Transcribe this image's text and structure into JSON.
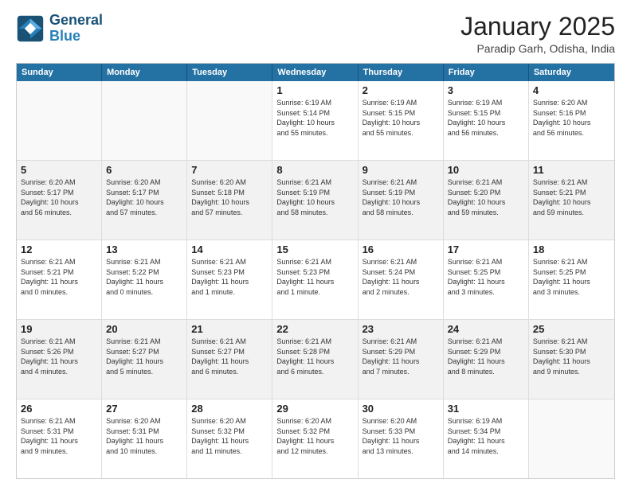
{
  "logo": {
    "line1": "General",
    "line2": "Blue"
  },
  "title": "January 2025",
  "location": "Paradip Garh, Odisha, India",
  "weekdays": [
    "Sunday",
    "Monday",
    "Tuesday",
    "Wednesday",
    "Thursday",
    "Friday",
    "Saturday"
  ],
  "rows": [
    [
      {
        "day": "",
        "text": ""
      },
      {
        "day": "",
        "text": ""
      },
      {
        "day": "",
        "text": ""
      },
      {
        "day": "1",
        "text": "Sunrise: 6:19 AM\nSunset: 5:14 PM\nDaylight: 10 hours\nand 55 minutes."
      },
      {
        "day": "2",
        "text": "Sunrise: 6:19 AM\nSunset: 5:15 PM\nDaylight: 10 hours\nand 55 minutes."
      },
      {
        "day": "3",
        "text": "Sunrise: 6:19 AM\nSunset: 5:15 PM\nDaylight: 10 hours\nand 56 minutes."
      },
      {
        "day": "4",
        "text": "Sunrise: 6:20 AM\nSunset: 5:16 PM\nDaylight: 10 hours\nand 56 minutes."
      }
    ],
    [
      {
        "day": "5",
        "text": "Sunrise: 6:20 AM\nSunset: 5:17 PM\nDaylight: 10 hours\nand 56 minutes."
      },
      {
        "day": "6",
        "text": "Sunrise: 6:20 AM\nSunset: 5:17 PM\nDaylight: 10 hours\nand 57 minutes."
      },
      {
        "day": "7",
        "text": "Sunrise: 6:20 AM\nSunset: 5:18 PM\nDaylight: 10 hours\nand 57 minutes."
      },
      {
        "day": "8",
        "text": "Sunrise: 6:21 AM\nSunset: 5:19 PM\nDaylight: 10 hours\nand 58 minutes."
      },
      {
        "day": "9",
        "text": "Sunrise: 6:21 AM\nSunset: 5:19 PM\nDaylight: 10 hours\nand 58 minutes."
      },
      {
        "day": "10",
        "text": "Sunrise: 6:21 AM\nSunset: 5:20 PM\nDaylight: 10 hours\nand 59 minutes."
      },
      {
        "day": "11",
        "text": "Sunrise: 6:21 AM\nSunset: 5:21 PM\nDaylight: 10 hours\nand 59 minutes."
      }
    ],
    [
      {
        "day": "12",
        "text": "Sunrise: 6:21 AM\nSunset: 5:21 PM\nDaylight: 11 hours\nand 0 minutes."
      },
      {
        "day": "13",
        "text": "Sunrise: 6:21 AM\nSunset: 5:22 PM\nDaylight: 11 hours\nand 0 minutes."
      },
      {
        "day": "14",
        "text": "Sunrise: 6:21 AM\nSunset: 5:23 PM\nDaylight: 11 hours\nand 1 minute."
      },
      {
        "day": "15",
        "text": "Sunrise: 6:21 AM\nSunset: 5:23 PM\nDaylight: 11 hours\nand 1 minute."
      },
      {
        "day": "16",
        "text": "Sunrise: 6:21 AM\nSunset: 5:24 PM\nDaylight: 11 hours\nand 2 minutes."
      },
      {
        "day": "17",
        "text": "Sunrise: 6:21 AM\nSunset: 5:25 PM\nDaylight: 11 hours\nand 3 minutes."
      },
      {
        "day": "18",
        "text": "Sunrise: 6:21 AM\nSunset: 5:25 PM\nDaylight: 11 hours\nand 3 minutes."
      }
    ],
    [
      {
        "day": "19",
        "text": "Sunrise: 6:21 AM\nSunset: 5:26 PM\nDaylight: 11 hours\nand 4 minutes."
      },
      {
        "day": "20",
        "text": "Sunrise: 6:21 AM\nSunset: 5:27 PM\nDaylight: 11 hours\nand 5 minutes."
      },
      {
        "day": "21",
        "text": "Sunrise: 6:21 AM\nSunset: 5:27 PM\nDaylight: 11 hours\nand 6 minutes."
      },
      {
        "day": "22",
        "text": "Sunrise: 6:21 AM\nSunset: 5:28 PM\nDaylight: 11 hours\nand 6 minutes."
      },
      {
        "day": "23",
        "text": "Sunrise: 6:21 AM\nSunset: 5:29 PM\nDaylight: 11 hours\nand 7 minutes."
      },
      {
        "day": "24",
        "text": "Sunrise: 6:21 AM\nSunset: 5:29 PM\nDaylight: 11 hours\nand 8 minutes."
      },
      {
        "day": "25",
        "text": "Sunrise: 6:21 AM\nSunset: 5:30 PM\nDaylight: 11 hours\nand 9 minutes."
      }
    ],
    [
      {
        "day": "26",
        "text": "Sunrise: 6:21 AM\nSunset: 5:31 PM\nDaylight: 11 hours\nand 9 minutes."
      },
      {
        "day": "27",
        "text": "Sunrise: 6:20 AM\nSunset: 5:31 PM\nDaylight: 11 hours\nand 10 minutes."
      },
      {
        "day": "28",
        "text": "Sunrise: 6:20 AM\nSunset: 5:32 PM\nDaylight: 11 hours\nand 11 minutes."
      },
      {
        "day": "29",
        "text": "Sunrise: 6:20 AM\nSunset: 5:32 PM\nDaylight: 11 hours\nand 12 minutes."
      },
      {
        "day": "30",
        "text": "Sunrise: 6:20 AM\nSunset: 5:33 PM\nDaylight: 11 hours\nand 13 minutes."
      },
      {
        "day": "31",
        "text": "Sunrise: 6:19 AM\nSunset: 5:34 PM\nDaylight: 11 hours\nand 14 minutes."
      },
      {
        "day": "",
        "text": ""
      }
    ]
  ]
}
